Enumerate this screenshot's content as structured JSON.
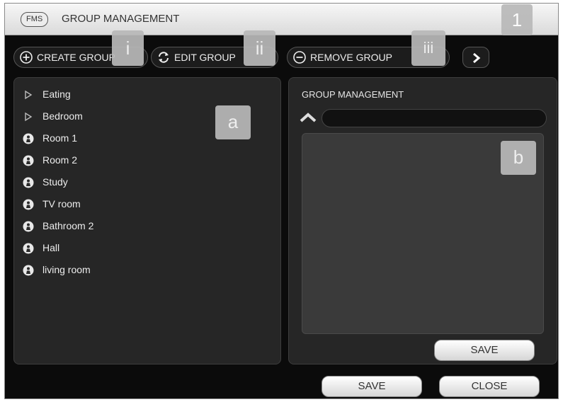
{
  "app": {
    "badge": "FMS",
    "title": "GROUP MANAGEMENT"
  },
  "markers": {
    "window": "1",
    "create": "i",
    "edit": "ii",
    "remove": "iii",
    "list": "a",
    "detail": "b"
  },
  "toolbar": {
    "create_label": "CREATE GROUP",
    "edit_label": "EDIT GROUP",
    "remove_label": "REMOVE GROUP"
  },
  "group_list": [
    {
      "label": "Eating",
      "icon": "expand-triangle-icon"
    },
    {
      "label": "Bedroom",
      "icon": "expand-triangle-icon"
    },
    {
      "label": "Room 1",
      "icon": "room-icon"
    },
    {
      "label": "Room 2",
      "icon": "room-icon"
    },
    {
      "label": "Study",
      "icon": "room-icon"
    },
    {
      "label": "TV room",
      "icon": "room-icon"
    },
    {
      "label": "Bathroom 2",
      "icon": "room-icon"
    },
    {
      "label": "Hall",
      "icon": "room-icon"
    },
    {
      "label": "living room",
      "icon": "room-icon"
    }
  ],
  "detail": {
    "title": "GROUP MANAGEMENT",
    "search_value": "",
    "save_label": "SAVE"
  },
  "footer": {
    "save_label": "SAVE",
    "close_label": "CLOSE"
  }
}
